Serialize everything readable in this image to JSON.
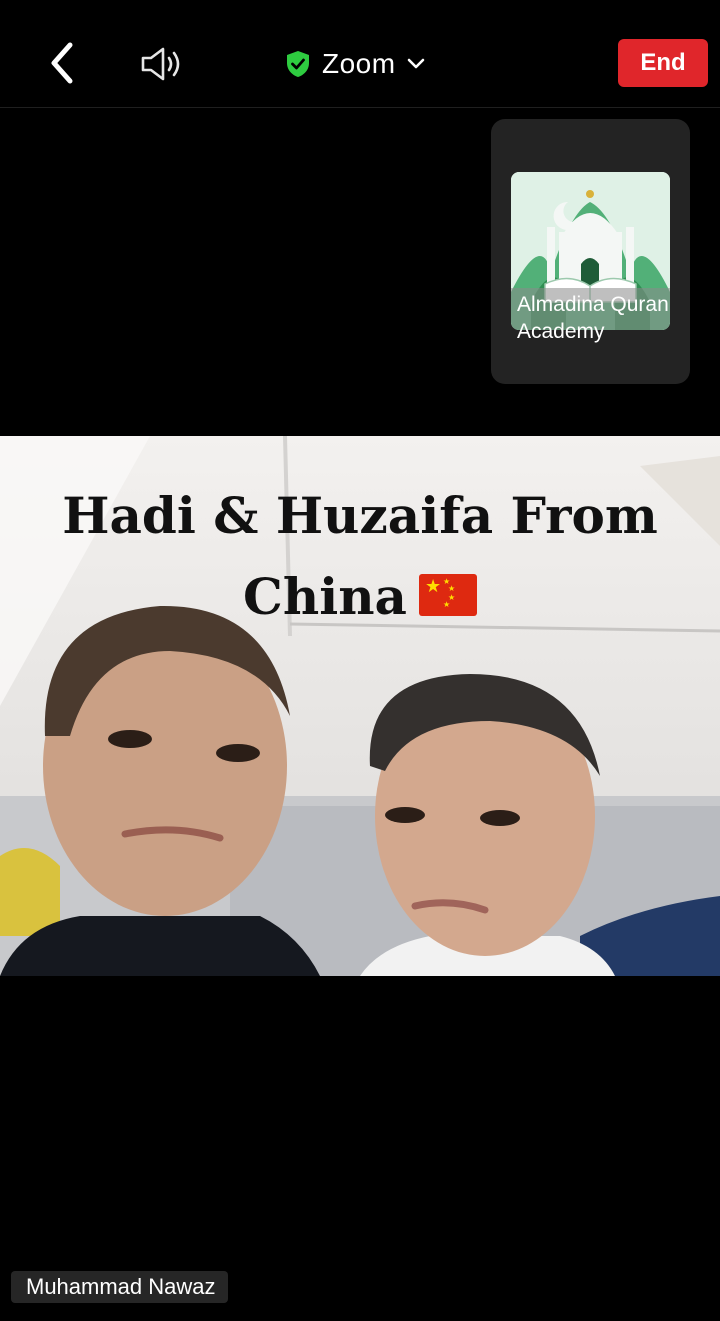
{
  "toolbar": {
    "title": "Zoom",
    "end_label": "End"
  },
  "participant_tile": {
    "name": "Almadina Quran Academy"
  },
  "video": {
    "overlay_line1": "Hadi & Huzaifa From",
    "overlay_line2": "China"
  },
  "active_speaker": {
    "name": "Muhammad Nawaz"
  },
  "colors": {
    "end_button": "#e0262b",
    "secure_shield": "#2ecc40",
    "background": "#000000"
  },
  "icons": [
    "back-arrow-icon",
    "speaker-icon",
    "shield-check-icon",
    "chevron-down-icon",
    "china-flag-icon"
  ]
}
